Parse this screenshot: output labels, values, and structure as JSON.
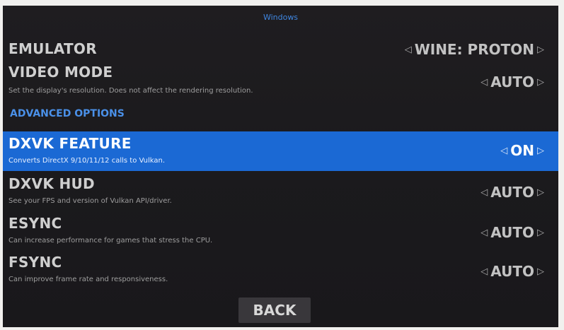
{
  "header": {
    "title": "Windows"
  },
  "settings": [
    {
      "name": "EMULATOR",
      "description": "",
      "value": "WINE: PROTON"
    },
    {
      "name": "VIDEO MODE",
      "description": "Set the display's resolution. Does not affect the rendering resolution.",
      "value": "AUTO"
    }
  ],
  "section_title": "ADVANCED OPTIONS",
  "advanced": [
    {
      "name": "DXVK FEATURE",
      "description": "Converts DirectX 9/10/11/12 calls to Vulkan.",
      "value": "ON",
      "selected": true
    },
    {
      "name": "DXVK HUD",
      "description": "See your FPS and version of Vulkan API/driver.",
      "value": "AUTO"
    },
    {
      "name": "ESYNC",
      "description": "Can increase performance for games that stress the CPU.",
      "value": "AUTO"
    },
    {
      "name": "FSYNC",
      "description": "Can improve frame rate and responsiveness.",
      "value": "AUTO"
    }
  ],
  "arrows": {
    "left": "◁",
    "right": "▷"
  },
  "back_button": {
    "label": "BACK"
  },
  "colors": {
    "accent": "#1b69d4",
    "section": "#4a90e8",
    "background": "#1d1c1f"
  }
}
